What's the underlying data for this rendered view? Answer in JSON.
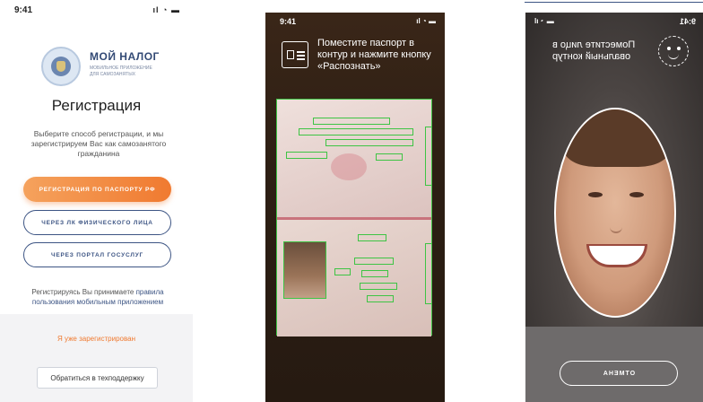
{
  "registration": {
    "status_time": "9:41",
    "status_icons": "ıl ◔ ▬",
    "logo_title": "МОЙ НАЛОГ",
    "logo_subtitle": "МОБИЛЬНОЕ ПРИЛОЖЕНИЕ ДЛЯ САМОЗАНЯТЫХ",
    "title": "Регистрация",
    "description": "Выберите способ регистрации, и мы зарегистрируем Вас как самозанятого гражданина",
    "btn_passport": "Регистрация по паспорту РФ",
    "btn_lk": "Через ЛК физического лица",
    "btn_gosuslugi": "Через портал госуслуг",
    "terms_text": "Регистрируясь Вы принимаете ",
    "terms_link": "правила пользования мобильным приложением",
    "already_registered": "Я уже зарегистрирован",
    "support_button": "Обратиться в техподдержку"
  },
  "passport_scan": {
    "status_time": "9:41",
    "status_icons": "ıl ◔ ▬",
    "icon": "passport-icon",
    "hint": "Поместите паспорт в контур и нажмите кнопку «Распознать»"
  },
  "face_scan": {
    "status_time": "9:41",
    "status_icons": "▬ ◔ ıl",
    "icon": "face-outline-icon",
    "hint": "Поместите лицо в овальный контур",
    "cancel_button": "ОТМЕНА"
  },
  "colors": {
    "accent_orange": "#f07a30",
    "brand_blue": "#3d5584",
    "detect_green": "#3ec444"
  }
}
